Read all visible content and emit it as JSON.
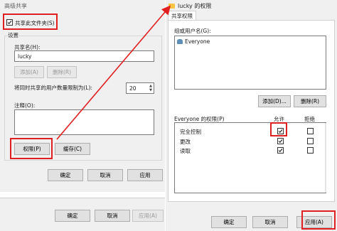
{
  "left_window": {
    "title": "高级共享",
    "share_checkbox_label": "共享此文件夹(S)",
    "share_checked": true,
    "settings_label": "设置",
    "share_name_label": "共享名(H):",
    "share_name_value": "lucky",
    "add_label": "添加(A)",
    "remove_label": "删除(R)",
    "limit_label": "将同时共享的用户数量限制为(L):",
    "limit_value": "20",
    "comment_label": "注释(O):",
    "permissions_label": "权限(P)",
    "caching_label": "缓存(C)",
    "ok_label": "确定",
    "cancel_label": "取消",
    "apply_label": "应用"
  },
  "bottom_bar": {
    "ok_label": "确定",
    "cancel_label": "取消",
    "apply_label": "应用(A)"
  },
  "right_window": {
    "title": "lucky 的权限",
    "tab_label": "共享权限",
    "group_label": "组或用户名(G):",
    "users": [
      "Everyone"
    ],
    "add_label": "添加(D)...",
    "remove_label": "删除(R)",
    "perm_header": "Everyone 的权限(P)",
    "allow_header": "允许",
    "deny_header": "拒绝",
    "permissions": [
      {
        "name": "完全控制",
        "allow": true,
        "deny": false
      },
      {
        "name": "更改",
        "allow": true,
        "deny": false
      },
      {
        "name": "读取",
        "allow": true,
        "deny": false
      }
    ],
    "ok_label": "确定",
    "cancel_label": "取消",
    "apply_label": "应用(A)"
  },
  "colors": {
    "highlight": "#e02020",
    "folder": "#f5c542"
  }
}
